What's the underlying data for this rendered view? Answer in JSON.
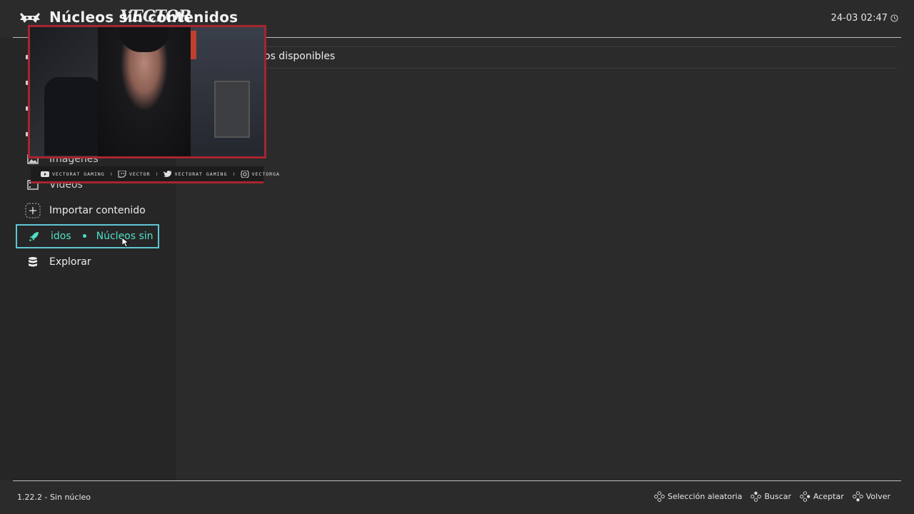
{
  "header": {
    "title": "Núcleos sin contenidos",
    "clock": "24-03 02:47"
  },
  "sidebar": {
    "items": [
      {
        "label": "Imágenes",
        "icon": "image-icon"
      },
      {
        "label": "Vídeos",
        "icon": "video-icon"
      },
      {
        "label": "Importar contenido",
        "icon": "plus-icon"
      },
      {
        "label_a": "idos",
        "label_b": "Núcleos sin",
        "icon": "rocket-icon",
        "selected": true
      },
      {
        "label": "Explorar",
        "icon": "database-icon"
      }
    ]
  },
  "content": {
    "row_label": "os disponibles"
  },
  "overlay": {
    "watermark": "VECTOR",
    "social": [
      {
        "icon": "youtube-icon",
        "text": "VECTORAT GAMING"
      },
      {
        "icon": "twitch-icon",
        "text": "VECTOR"
      },
      {
        "icon": "twitter-icon",
        "text": "VECTORAT GAMING"
      },
      {
        "icon": "instagram-icon",
        "text": "VECTORGA"
      }
    ]
  },
  "footer": {
    "version": "1.22.2 - Sin núcleo",
    "hints": [
      {
        "label": "Selección aleatoria"
      },
      {
        "label": "Buscar"
      },
      {
        "label": "Aceptar"
      },
      {
        "label": "Volver"
      }
    ]
  },
  "colors": {
    "background": "#2b2b2b",
    "sidebar": "#262626",
    "selected_border": "#5fc6d3",
    "selected_text": "#4fe0c6",
    "webcam_frame": "#a7252f"
  }
}
